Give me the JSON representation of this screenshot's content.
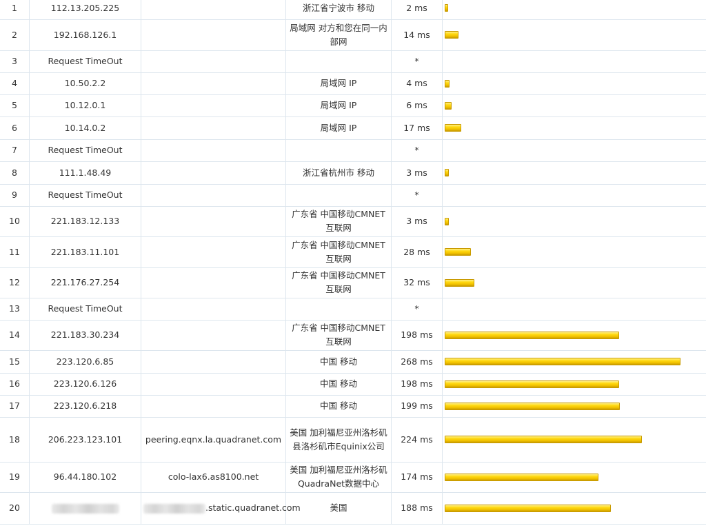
{
  "rows": [
    {
      "hop": "1",
      "ip": "112.13.205.225",
      "host": "",
      "loc": "浙江省宁波市 移动",
      "time": "2 ms",
      "ms": 2
    },
    {
      "hop": "2",
      "ip": "192.168.126.1",
      "host": "",
      "loc": "局域网 对方和您在同一内部网",
      "time": "14 ms",
      "ms": 14
    },
    {
      "hop": "3",
      "ip": "Request TimeOut",
      "host": "",
      "loc": "",
      "time": "*",
      "ms": 0
    },
    {
      "hop": "4",
      "ip": "10.50.2.2",
      "host": "",
      "loc": "局域网 IP",
      "time": "4 ms",
      "ms": 4
    },
    {
      "hop": "5",
      "ip": "10.12.0.1",
      "host": "",
      "loc": "局域网 IP",
      "time": "6 ms",
      "ms": 6
    },
    {
      "hop": "6",
      "ip": "10.14.0.2",
      "host": "",
      "loc": "局域网 IP",
      "time": "17 ms",
      "ms": 17
    },
    {
      "hop": "7",
      "ip": "Request TimeOut",
      "host": "",
      "loc": "",
      "time": "*",
      "ms": 0
    },
    {
      "hop": "8",
      "ip": "111.1.48.49",
      "host": "",
      "loc": "浙江省杭州市 移动",
      "time": "3 ms",
      "ms": 3
    },
    {
      "hop": "9",
      "ip": "Request TimeOut",
      "host": "",
      "loc": "",
      "time": "*",
      "ms": 0
    },
    {
      "hop": "10",
      "ip": "221.183.12.133",
      "host": "",
      "loc": "广东省 中国移动CMNET互联网",
      "time": "3 ms",
      "ms": 3
    },
    {
      "hop": "11",
      "ip": "221.183.11.101",
      "host": "",
      "loc": "广东省 中国移动CMNET互联网",
      "time": "28 ms",
      "ms": 28
    },
    {
      "hop": "12",
      "ip": "221.176.27.254",
      "host": "",
      "loc": "广东省 中国移动CMNET互联网",
      "time": "32 ms",
      "ms": 32
    },
    {
      "hop": "13",
      "ip": "Request TimeOut",
      "host": "",
      "loc": "",
      "time": "*",
      "ms": 0
    },
    {
      "hop": "14",
      "ip": "221.183.30.234",
      "host": "",
      "loc": "广东省 中国移动CMNET互联网",
      "time": "198 ms",
      "ms": 198
    },
    {
      "hop": "15",
      "ip": "223.120.6.85",
      "host": "",
      "loc": "中国 移动",
      "time": "268 ms",
      "ms": 268
    },
    {
      "hop": "16",
      "ip": "223.120.6.126",
      "host": "",
      "loc": "中国 移动",
      "time": "198 ms",
      "ms": 198
    },
    {
      "hop": "17",
      "ip": "223.120.6.218",
      "host": "",
      "loc": "中国 移动",
      "time": "199 ms",
      "ms": 199
    },
    {
      "hop": "18",
      "ip": "206.223.123.101",
      "host": "peering.eqnx.la.quadranet.com",
      "loc": "美国 加利福尼亚州洛杉矶县洛杉矶市Equinix公司",
      "time": "224 ms",
      "ms": 224
    },
    {
      "hop": "19",
      "ip": "96.44.180.102",
      "host": "colo-lax6.as8100.net",
      "loc": "美国 加利福尼亚州洛杉矶QuadraNet数据中心",
      "time": "174 ms",
      "ms": 174
    },
    {
      "hop": "20",
      "ip": "",
      "ip_redacted": true,
      "host": ".static.quadranet.com",
      "host_redacted_prefix": true,
      "loc": "美国",
      "time": "188 ms",
      "ms": 188
    }
  ],
  "bar_max_ms": 268,
  "colors": {
    "bar": "#ffd912",
    "bar_border": "#c89a00",
    "grid": "#dde6ee",
    "text": "#333333"
  }
}
